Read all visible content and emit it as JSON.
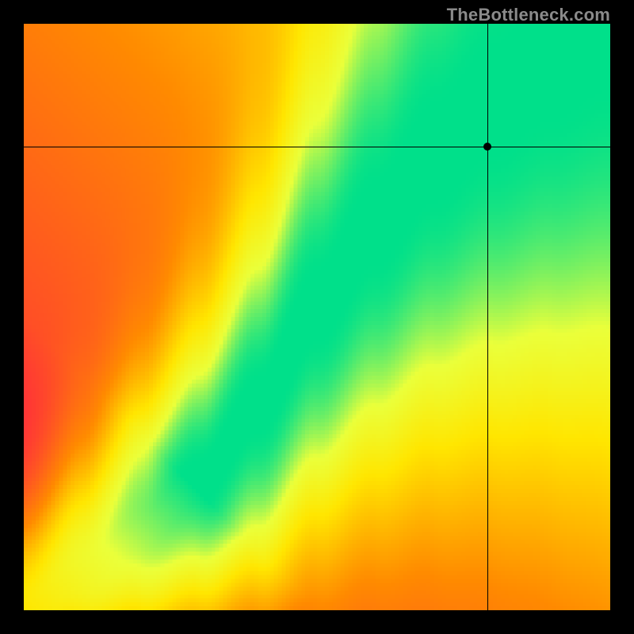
{
  "watermark": "TheBottleneck.com",
  "chart_data": {
    "type": "heatmap",
    "title": "",
    "xlabel": "",
    "ylabel": "",
    "xlim": [
      0,
      1
    ],
    "ylim": [
      0,
      1
    ],
    "grid": false,
    "legend": false,
    "marker": {
      "x": 0.79,
      "y": 0.79
    },
    "crosshair": {
      "x": 0.79,
      "y": 0.79
    },
    "colorscale": [
      {
        "t": 0.0,
        "color": "#ff1f44"
      },
      {
        "t": 0.45,
        "color": "#ff8a00"
      },
      {
        "t": 0.7,
        "color": "#ffe600"
      },
      {
        "t": 0.85,
        "color": "#eaff3a"
      },
      {
        "t": 1.0,
        "color": "#00e08a"
      }
    ],
    "ridge_curve_description": "monotone s-curve from origin to top-right, inflection near center, diagonal above midpoint",
    "ridge_samples": [
      {
        "x": 0.0,
        "y": 0.0
      },
      {
        "x": 0.1,
        "y": 0.06
      },
      {
        "x": 0.2,
        "y": 0.13
      },
      {
        "x": 0.3,
        "y": 0.22
      },
      {
        "x": 0.4,
        "y": 0.35
      },
      {
        "x": 0.5,
        "y": 0.52
      },
      {
        "x": 0.6,
        "y": 0.66
      },
      {
        "x": 0.7,
        "y": 0.78
      },
      {
        "x": 0.8,
        "y": 0.87
      },
      {
        "x": 0.9,
        "y": 0.94
      },
      {
        "x": 1.0,
        "y": 1.0
      }
    ],
    "band_halfwidth": {
      "start": 0.006,
      "end": 0.065
    },
    "resolution": 150
  }
}
